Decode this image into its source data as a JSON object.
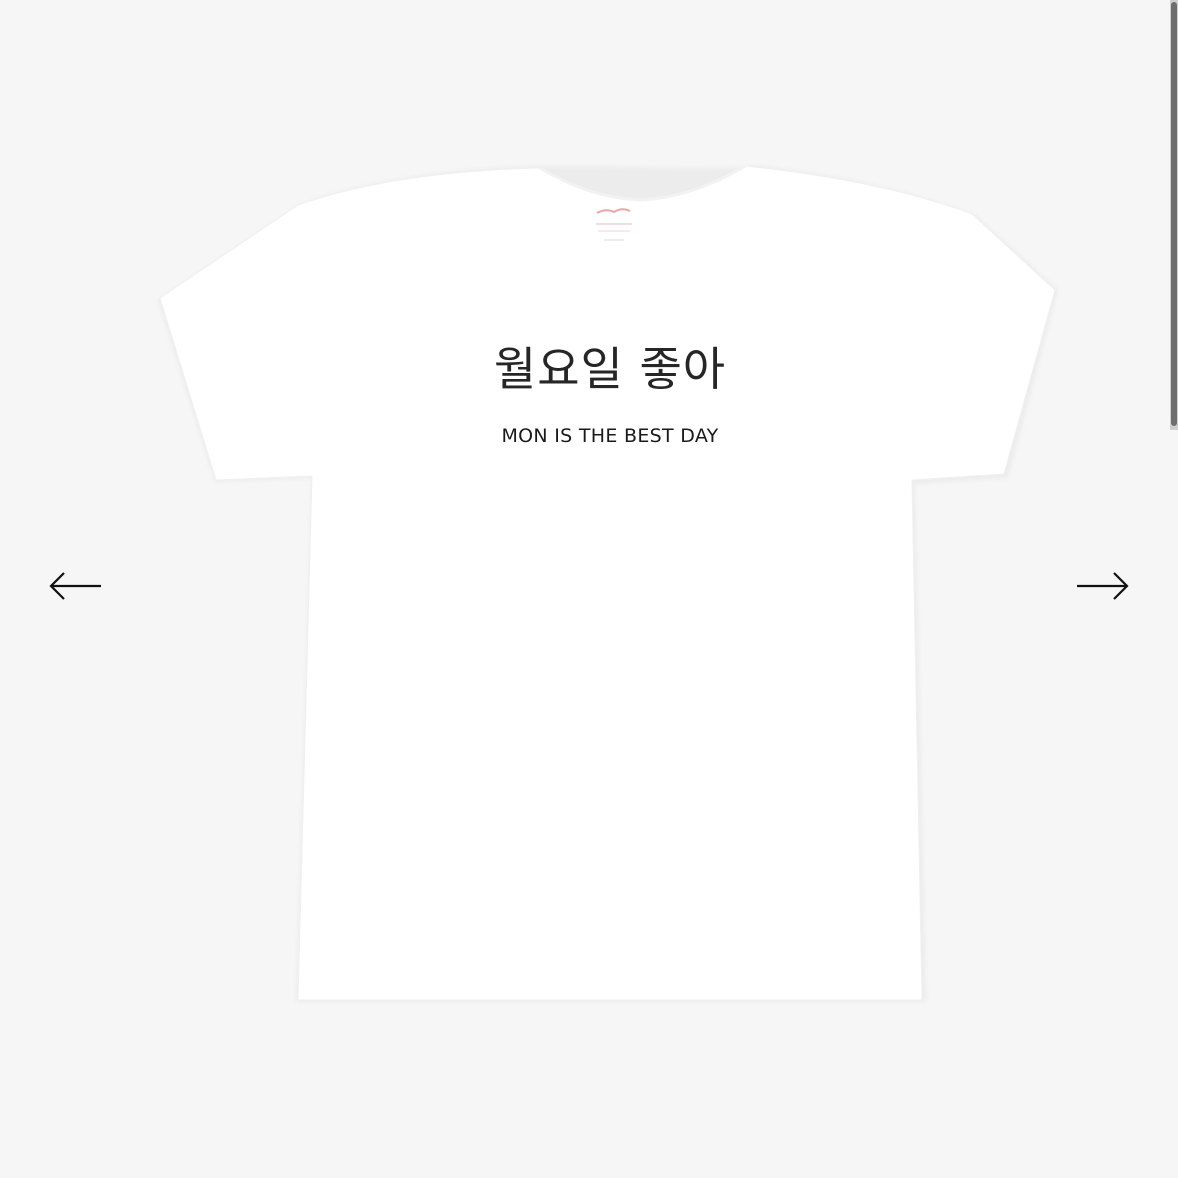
{
  "gallery": {
    "product_print": {
      "korean_line": "월요일 좋아",
      "english_line": "MON IS THE BEST DAY"
    },
    "prev_icon": "arrow-left-icon",
    "next_icon": "arrow-right-icon",
    "background_color": "#f6f6f6",
    "shirt_color": "#ffffff"
  }
}
